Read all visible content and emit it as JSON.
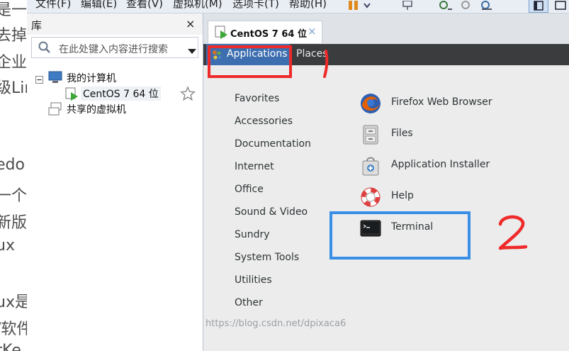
{
  "background_page": {
    "fragments": [
      "是一",
      "去掉",
      "企业",
      "级Lin",
      "edo",
      "一个",
      "新版",
      "ux",
      "ux是",
      "/软件",
      "rKe"
    ]
  },
  "menubar": {
    "items": [
      "文件(F)",
      "编辑(E)",
      "查看(V)",
      "虚拟机(M)",
      "选项卡(T)",
      "帮助(H)"
    ]
  },
  "library": {
    "title": "库",
    "close": "×",
    "search": {
      "placeholder": "在此处键入内容进行搜索"
    },
    "tree": {
      "root": "我的计算机",
      "vm": "CentOS 7 64 位",
      "shared": "共享的虚拟机"
    }
  },
  "tab": {
    "label": "CentOS 7 64 位",
    "close": "×"
  },
  "gnome": {
    "applications": "Applications",
    "places": "Places"
  },
  "categories": [
    "Favorites",
    "Accessories",
    "Documentation",
    "Internet",
    "Office",
    "Sound & Video",
    "Sundry",
    "System Tools",
    "Utilities",
    "Other"
  ],
  "apps": [
    {
      "label": "Firefox Web Browser",
      "icon": "firefox-icon"
    },
    {
      "label": "Files",
      "icon": "files-icon"
    },
    {
      "label": "Application Installer",
      "icon": "installer-icon"
    },
    {
      "label": "Help",
      "icon": "help-lifebuoy-icon"
    },
    {
      "label": "Terminal",
      "icon": "terminal-icon"
    }
  ],
  "annotations": {
    "one": "1",
    "two": "2"
  },
  "watermark": "https://blog.csdn.net/dpixaca6",
  "colors": {
    "annotation_red": "#ef2a2a",
    "annotation_blue": "#3a8ee6",
    "applications_highlight": "#3d6fb0",
    "gnome_bar": "#3a3c3e"
  }
}
